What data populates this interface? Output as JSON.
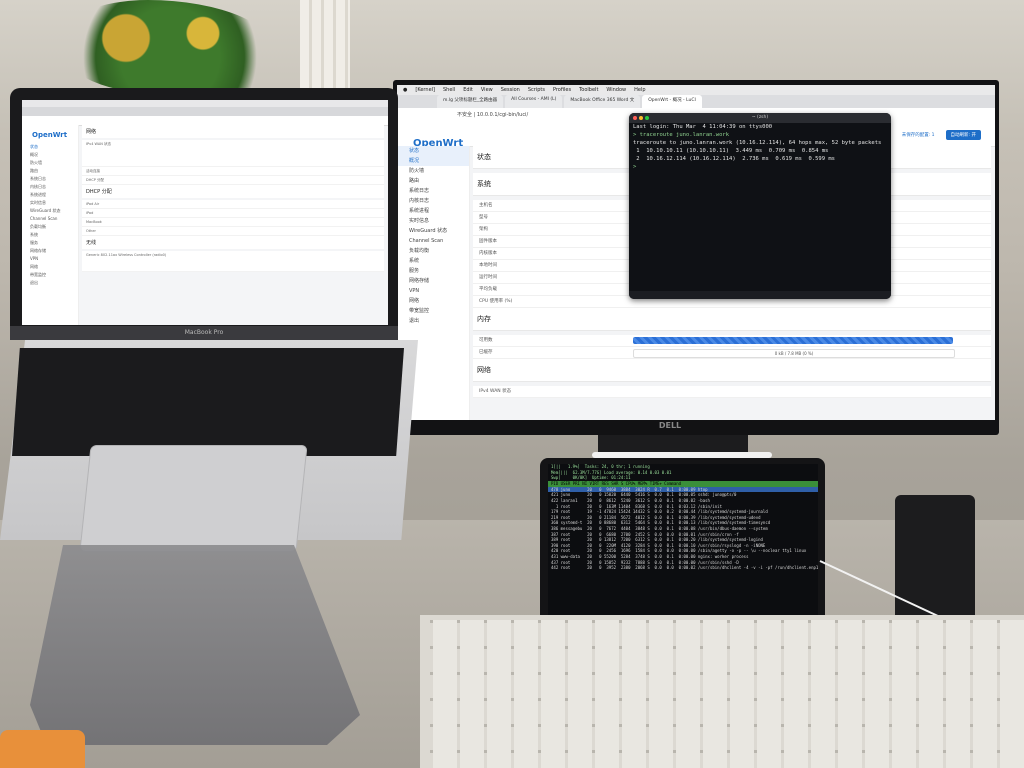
{
  "monitor": {
    "menubar": [
      "[Kernel]",
      "Shell",
      "Edit",
      "View",
      "Session",
      "Scripts",
      "Profiles",
      "Toolbelt",
      "Window",
      "Help"
    ],
    "tabs": [
      "m.lg 父项标题栏_全路由器",
      "All Courses - AMI (L)",
      "MacBook Office 365 Word 文",
      "OpenWrt - 概况 - LuCI"
    ],
    "url": "不安全 | 10.0.0.1/cgi-bin/luci/",
    "header_buttons": [
      "未保存的配置: 1",
      "自动刷新: 开"
    ],
    "logo": "OpenWrt",
    "sidebar": [
      "状态",
      "概况",
      "防火墙",
      "路由",
      "系统日志",
      "内核日志",
      "系统进程",
      "实时信息",
      "WireGuard 状态",
      "Channel Scan",
      "负载均衡",
      "系统",
      "服务",
      "网络存储",
      "VPN",
      "网络",
      "带宽监控",
      "退出"
    ],
    "status_title": "状态",
    "system_section": "系统",
    "system_rows": [
      "主机名",
      "型号",
      "架构",
      "固件版本",
      "内核版本",
      "本地时间",
      "运行时间",
      "平均负载",
      "CPU 使用率 (%)"
    ],
    "memory_section": "内存",
    "memory_rows": [
      "可用数",
      "已缓存"
    ],
    "memory_value": "0 kB / 7.8 MB (0 %)",
    "network_section": "网络",
    "network_row": "IPv4 WAN 状态"
  },
  "terminal": {
    "title": "~ (zsh)",
    "lines": [
      "Last login: Thu Mar  4 11:04:39 on ttys000",
      "> traceroute juno.lanran.work",
      "traceroute to juno.lanran.work (10.16.12.114), 64 hops max, 52 byte packets",
      " 1  10.10.10.11 (10.10.10.11)  3.449 ms  0.709 ms  0.854 ms",
      " 2  10.16.12.114 (10.16.12.114)  2.736 ms  0.619 ms  0.599 ms",
      "> "
    ]
  },
  "laptop": {
    "brand_label": "MacBook Pro",
    "logo": "OpenWrt",
    "sidebar": [
      "状态",
      "概况",
      "防火墙",
      "路由",
      "系统日志",
      "内核日志",
      "系统进程",
      "实时信息",
      "WireGuard 状态",
      "Channel Scan",
      "负载均衡",
      "系统",
      "服务",
      "网络存储",
      "VPN",
      "网络",
      "带宽监控",
      "退出"
    ],
    "network_card": "网络",
    "network_rows": [
      "IPv4 WAN 状态",
      "活动连接",
      "DHCP 分配"
    ],
    "dhcp_title": "DHCP 分配",
    "dhcp_rows": [
      "iPad Air",
      "iPad",
      "MacBook",
      "Other"
    ],
    "wireless_title": "无线",
    "wireless_row": "Generic 802.11ax Wireless Controller (radio0)"
  },
  "ipad": {
    "header": [
      "1[||   1.9%]  Tasks: 24, 0 thr; 1 running",
      "Mem[|||  62.3M/7.77G] Load average: 0.14 0.03 0.01",
      "Swp[     0K/0K]  Uptime: 01:24:11"
    ],
    "columns": "PID USER      PRI  NI  VIRT   RES   SHR S CPU% MEM%   TIME+  Command",
    "rows": [
      "478 juno       20   0  9460  3884  3024 R  0.7  0.1  0:00.09 htop",
      "421 juno       20   0 15020  6440  5416 S  0.0  0.1  0:00.05 sshd: juno@pts/0",
      "422 lanran1    20   0  8612  5240  3612 S  0.0  0.1  0:00.02 -bash",
      "  1 root       20   0  163M 11404  8368 S  0.0  0.1  0:03.12 /sbin/init",
      "179 root       19  -1 47824 15424 14432 S  0.0  0.2  0:00.44 /lib/systemd/systemd-journald",
      "219 root       20   0 21184  5672  4012 S  0.0  0.1  0:00.39 /lib/systemd/systemd-udevd",
      "360 systemd-t  20   0 88680  6312  5464 S  0.0  0.1  0:00.13 /lib/systemd/systemd-timesyncd",
      "386 messagebu  20   0  7672  4404  3848 S  0.0  0.1  0:00.08 /usr/bin/dbus-daemon --system",
      "387 root       20   0  6680  2700  2452 S  0.0  0.0  0:00.01 /usr/sbin/cron -f",
      "389 root       20   0 13812  7200  6312 S  0.0  0.1  0:00.20 /lib/systemd/systemd-logind",
      "390 root       20   0  220M  4120  3284 S  0.0  0.1  0:00.10 /usr/sbin/rsyslogd -n -iNONE",
      "420 root       20   0  2456  1696  1584 S  0.0  0.0  0:00.00 /sbin/agetty -o -p -- \\u --noclear tty1 linux",
      "431 www-data   20   0 55200  5284  3748 S  0.0  0.1  0:00.00 nginx: worker process",
      "437 root       20   0 15852  9232  7888 S  0.0  0.1  0:00.00 /usr/sbin/sshd -D",
      "442 root       20   0  3952  2380  2068 S  0.0  0.0  0:00.02 /usr/sbin/dhclient -4 -v -i -pf /run/dhclient.enp1s"
    ]
  },
  "colors": {
    "openwrt_blue": "#1e6ec8",
    "terminal_bg": "#0f1115",
    "htop_green": "#3a8f3a"
  }
}
